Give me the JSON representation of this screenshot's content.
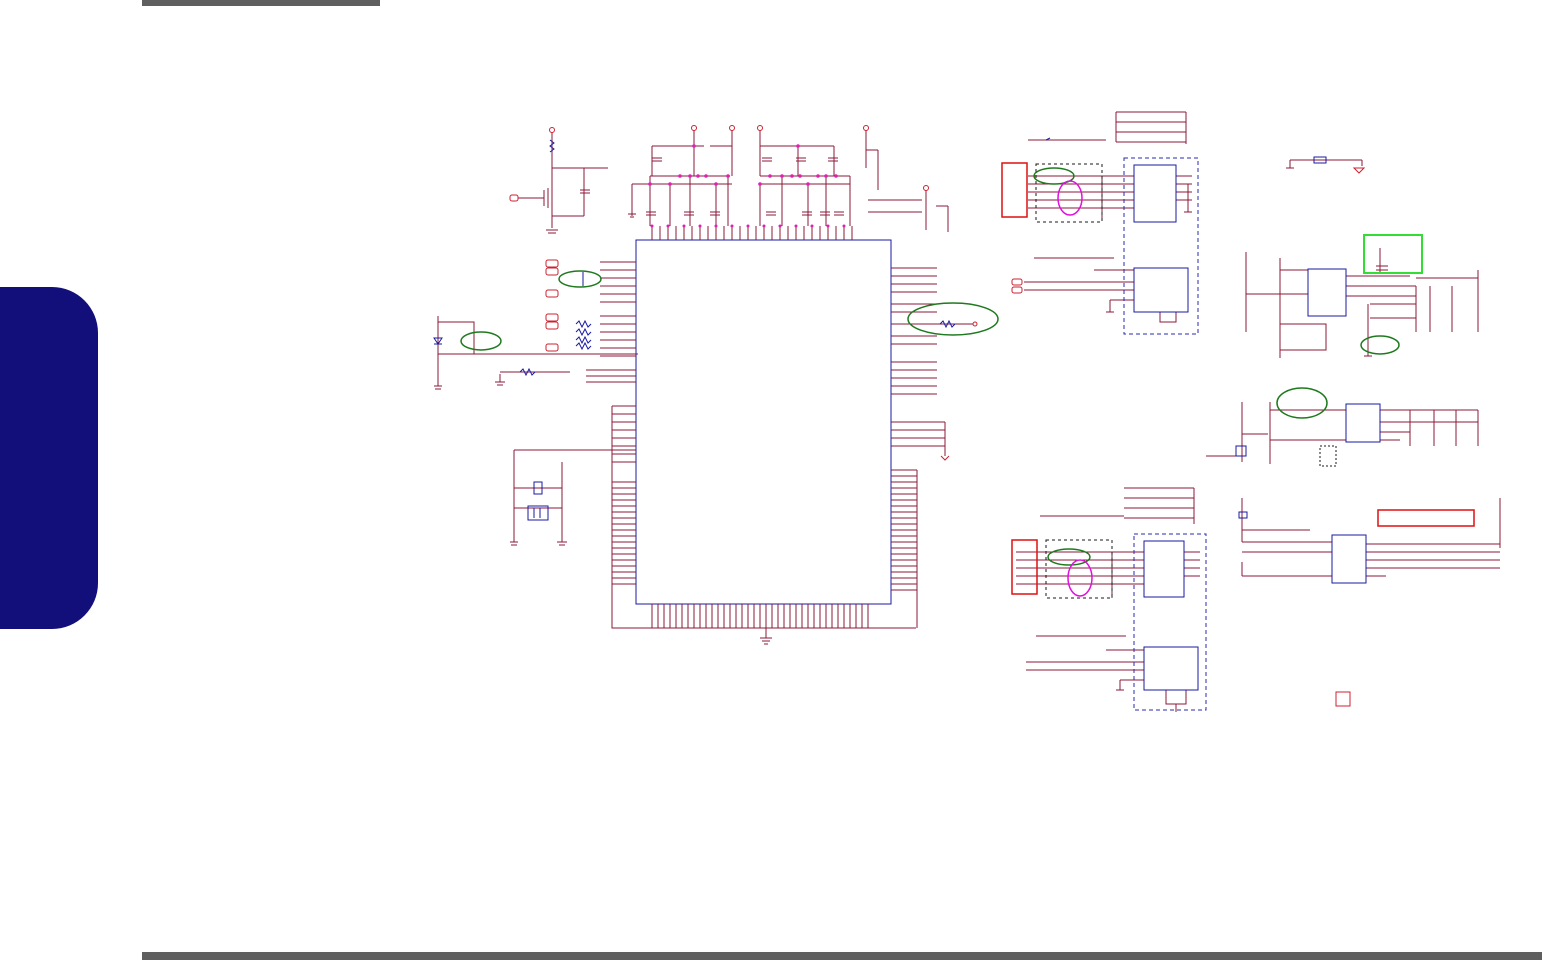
{
  "page": {
    "side_tab_color": "#120f7a",
    "rule_color": "#5f5f5f"
  },
  "schematic": {
    "wire_color": "#8b1a3a",
    "component_color": "#1a1aa0",
    "pin_color": "#e020b0",
    "label_color": "#cc2030",
    "highlight_green": "#1e7a1e",
    "highlight_bright_green": "#33dd33",
    "highlight_red": "#dd1111",
    "highlight_magenta": "#e010e0",
    "block_outline_color": "#2a2ab0"
  }
}
